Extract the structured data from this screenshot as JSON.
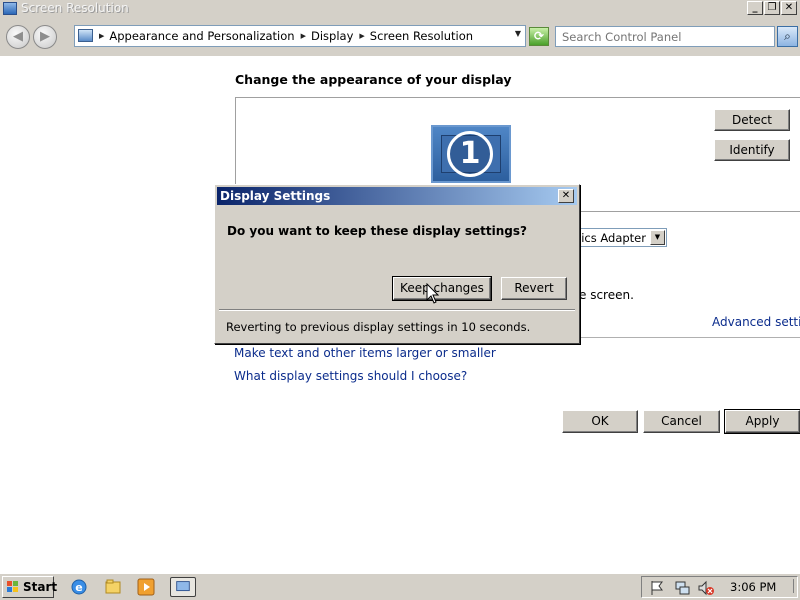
{
  "window": {
    "title": "Screen Resolution",
    "controls": {
      "minimize": "_",
      "restore": "❐",
      "close": "✕"
    }
  },
  "addressbar": {
    "back": "◀",
    "forward": "▶",
    "breadcrumbs": [
      "Appearance and Personalization",
      "Display",
      "Screen Resolution"
    ],
    "search_placeholder": "Search Control Panel"
  },
  "main": {
    "heading": "Change the appearance of your display",
    "monitor_number": "1",
    "detect_button": "Detect",
    "identify_button": "Identify",
    "display_select_partial": "aphics Adapter",
    "partial_text": "e screen.",
    "advanced_link": "Advanced settings",
    "link_text_size": "Make text and other items larger or smaller",
    "link_help": "What display settings should I choose?",
    "ok_button": "OK",
    "cancel_button": "Cancel",
    "apply_button": "Apply"
  },
  "dialog": {
    "title": "Display Settings",
    "close": "✕",
    "question": "Do you want to keep these display settings?",
    "keep_button": "Keep changes",
    "revert_button": "Revert",
    "status": "Reverting to previous display settings in 10 seconds."
  },
  "taskbar": {
    "start": "Start",
    "clock": "3:06 PM"
  }
}
